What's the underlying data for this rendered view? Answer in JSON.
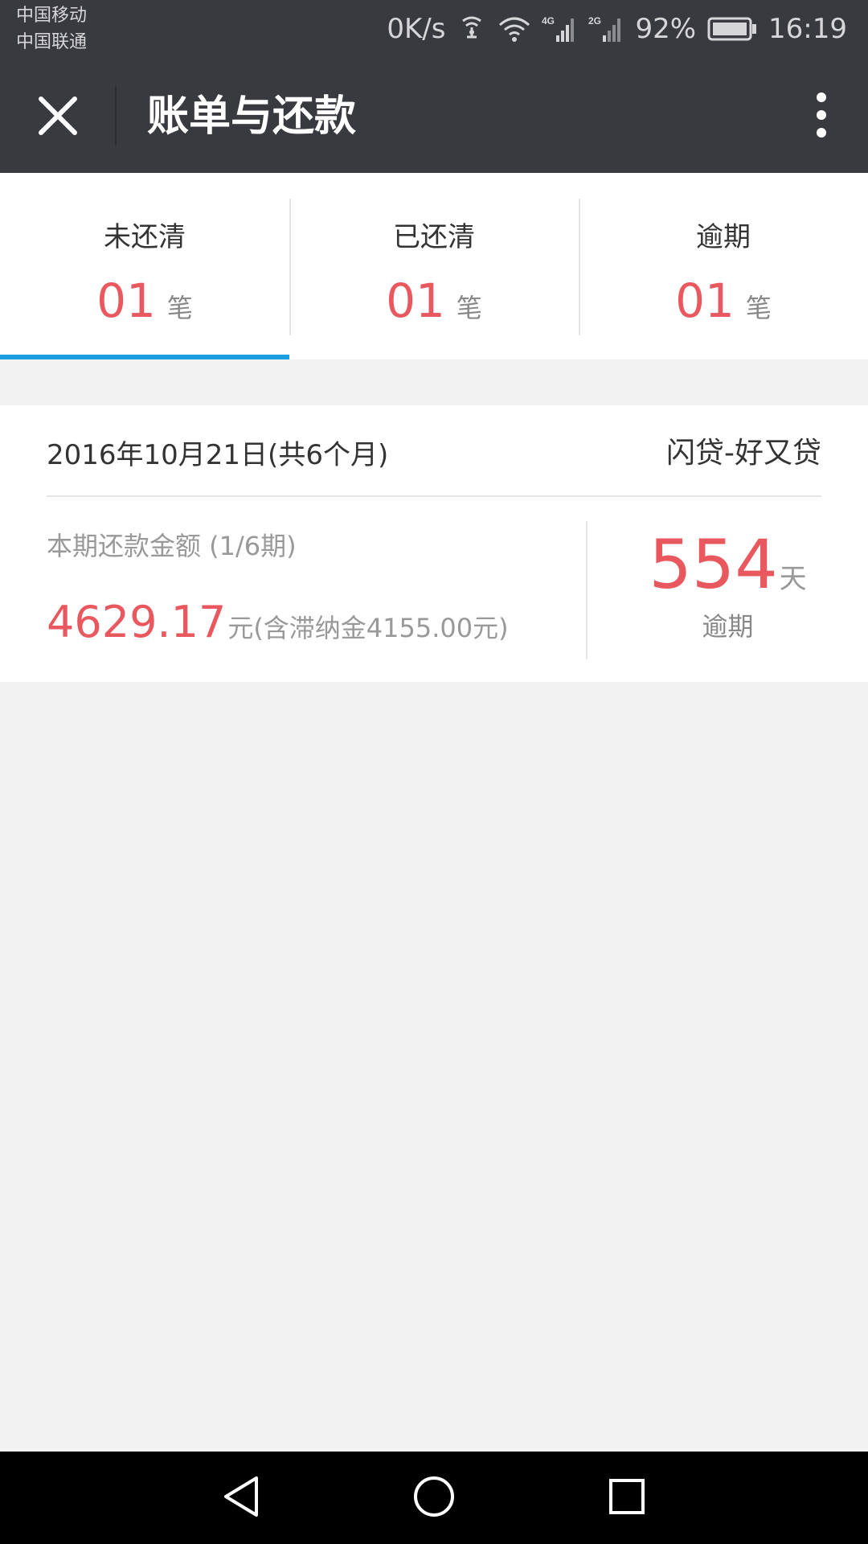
{
  "status_bar": {
    "carrier_1": "中国移动",
    "carrier_2": "中国联通",
    "net_speed": "0K/s",
    "signal_1_type": "4G",
    "signal_2_type": "2G",
    "battery": "92%",
    "time": "16:19",
    "icons": [
      "nfc-icon",
      "wifi-icon",
      "signal-4g-icon",
      "signal-2g-icon",
      "battery-icon"
    ]
  },
  "header": {
    "title": "账单与还款",
    "close_icon": "close-icon",
    "more_icon": "more-vertical-icon"
  },
  "tabs": [
    {
      "label": "未还清",
      "count": "01",
      "unit": "笔",
      "active": true
    },
    {
      "label": "已还清",
      "count": "01",
      "unit": "笔",
      "active": false
    },
    {
      "label": "逾期",
      "count": "01",
      "unit": "笔",
      "active": false
    }
  ],
  "bill": {
    "date": "2016年10月21日(共6个月)",
    "product": "闪贷-好又贷",
    "amount_label": "本期还款金额 (1/6期)",
    "amount": "4629.17",
    "amount_note": "元(含滞纳金4155.00元)",
    "overdue_days": "554",
    "overdue_unit": "天",
    "overdue_label": "逾期"
  },
  "colors": {
    "header_bg": "#393a3f",
    "accent_red": "#e9585e",
    "tab_indicator": "#1a9fe0",
    "page_bg": "#f2f2f2"
  },
  "nav_bar": {
    "icons": [
      "back-triangle-icon",
      "home-circle-icon",
      "recent-square-icon"
    ]
  }
}
